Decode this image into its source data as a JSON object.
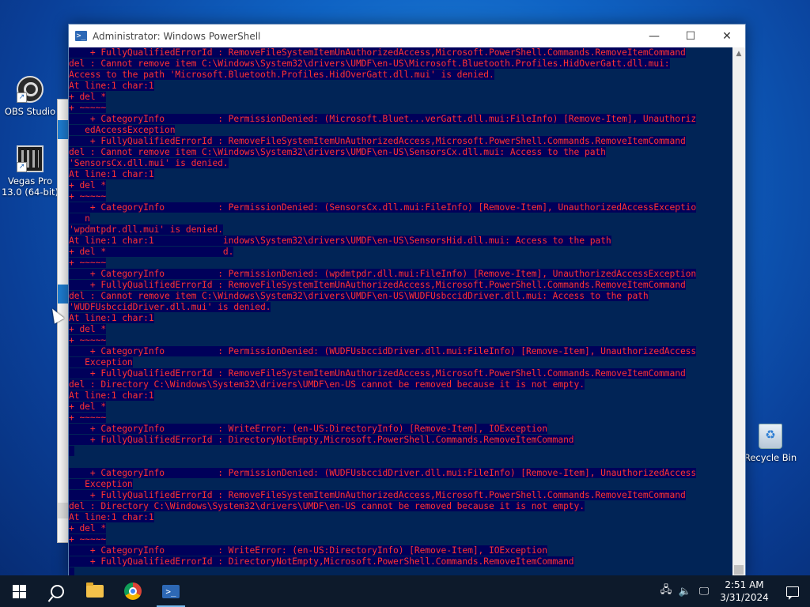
{
  "desktop": {
    "icons": [
      {
        "label": "OBS Studio",
        "icon": "obs-studio-icon"
      },
      {
        "label": "Vegas Pro 13.0 (64-bit)",
        "icon": "vegas-pro-icon"
      },
      {
        "label": "Recycle Bin",
        "icon": "recycle-bin-icon"
      }
    ]
  },
  "window": {
    "title": "Administrator: Windows PowerShell",
    "buttons": {
      "minimize": "—",
      "maximize": "☐",
      "close": "✕"
    }
  },
  "console": {
    "lines": [
      "    + FullyQualifiedErrorId : RemoveFileSystemItemUnAuthorizedAccess,Microsoft.PowerShell.Commands.RemoveItemCommand",
      "del : Cannot remove item C:\\Windows\\System32\\drivers\\UMDF\\en-US\\Microsoft.Bluetooth.Profiles.HidOverGatt.dll.mui:",
      "Access to the path 'Microsoft.Bluetooth.Profiles.HidOverGatt.dll.mui' is denied.",
      "At line:1 char:1",
      "+ del *",
      "+ ~~~~~",
      "    + CategoryInfo          : PermissionDenied: (Microsoft.Bluet...verGatt.dll.mui:FileInfo) [Remove-Item], Unauthoriz",
      "   edAccessException",
      "    + FullyQualifiedErrorId : RemoveFileSystemItemUnAuthorizedAccess,Microsoft.PowerShell.Commands.RemoveItemCommand",
      "del : Cannot remove item C:\\Windows\\System32\\drivers\\UMDF\\en-US\\SensorsCx.dll.mui: Access to the path",
      "'SensorsCx.dll.mui' is denied.",
      "At line:1 char:1",
      "+ del *",
      "+ ~~~~~",
      "    + CategoryInfo          : PermissionDenied: (SensorsCx.dll.mui:FileInfo) [Remove-Item], UnauthorizedAccessExceptio",
      "   n",
      "'wpdmtpdr.dll.mui' is denied.",
      "At line:1 char:1             indows\\System32\\drivers\\UMDF\\en-US\\SensorsHid.dll.mui: Access to the path",
      "+ del *                      d.",
      "+ ~~~~~",
      "    + CategoryInfo          : PermissionDenied: (wpdmtpdr.dll.mui:FileInfo) [Remove-Item], UnauthorizedAccessException",
      "    + FullyQualifiedErrorId : RemoveFileSystemItemUnAuthorizedAccess,Microsoft.PowerShell.Commands.RemoveItemCommand",
      "del : Cannot remove item C:\\Windows\\System32\\drivers\\UMDF\\en-US\\WUDFUsbccidDriver.dll.mui: Access to the path",
      "'WUDFUsbccidDriver.dll.mui' is denied.",
      "At line:1 char:1",
      "+ del *",
      "+ ~~~~~",
      "    + CategoryInfo          : PermissionDenied: (WUDFUsbccidDriver.dll.mui:FileInfo) [Remove-Item], UnauthorizedAccess",
      "   Exception",
      "    + FullyQualifiedErrorId : RemoveFileSystemItemUnAuthorizedAccess,Microsoft.PowerShell.Commands.RemoveItemCommand",
      "del : Directory C:\\Windows\\System32\\drivers\\UMDF\\en-US cannot be removed because it is not empty.",
      "At line:1 char:1",
      "+ del *",
      "+ ~~~~~",
      "    + CategoryInfo          : WriteError: (en-US:DirectoryInfo) [Remove-Item], IOException",
      "    + FullyQualifiedErrorId : DirectoryNotEmpty,Microsoft.PowerShell.Commands.RemoveItemCommand",
      " ",
      "",
      "    + CategoryInfo          : PermissionDenied: (WUDFUsbccidDriver.dll.mui:FileInfo) [Remove-Item], UnauthorizedAccess",
      "   Exception",
      "    + FullyQualifiedErrorId : RemoveFileSystemItemUnAuthorizedAccess,Microsoft.PowerShell.Commands.RemoveItemCommand",
      "del : Directory C:\\Windows\\System32\\drivers\\UMDF\\en-US cannot be removed because it is not empty.",
      "At line:1 char:1",
      "+ del *",
      "+ ~~~~~",
      "    + CategoryInfo          : WriteError: (en-US:DirectoryInfo) [Remove-Item], IOException",
      "    + FullyQualifiedErrorId : DirectoryNotEmpty,Microsoft.PowerShell.Commands.RemoveItemCommand",
      " "
    ]
  },
  "taskbar": {
    "apps": [
      {
        "name": "start-button",
        "icon": "windows-logo-icon"
      },
      {
        "name": "search-button",
        "icon": "search-icon"
      },
      {
        "name": "file-explorer-button",
        "icon": "folder-icon"
      },
      {
        "name": "chrome-button",
        "icon": "chrome-icon"
      },
      {
        "name": "powershell-button",
        "icon": "powershell-icon",
        "active": true
      }
    ],
    "clock": {
      "time": "2:51 AM",
      "date": "3/31/2024"
    }
  },
  "colors": {
    "console_bg": "#012456",
    "error_text": "#ff3232",
    "error_highlight": "#00005a",
    "taskbar_bg": "#0d1a2b"
  }
}
